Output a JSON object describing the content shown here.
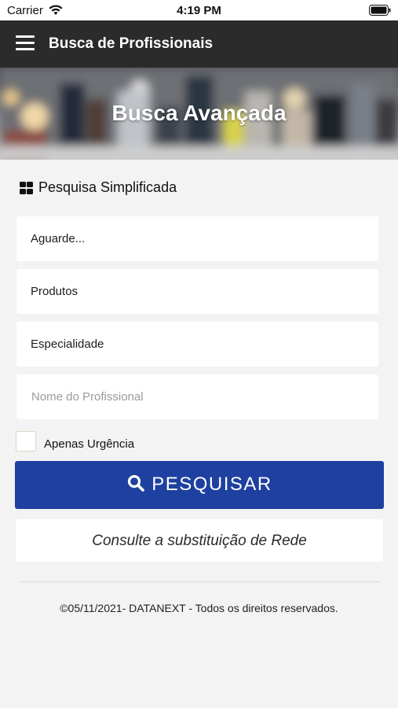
{
  "status_bar": {
    "carrier": "Carrier",
    "time": "4:19 PM",
    "icons": [
      "wifi-icon",
      "battery-icon"
    ]
  },
  "app_bar": {
    "title": "Busca de Profissionais",
    "menu_icon": "hamburger-menu-icon"
  },
  "banner": {
    "title": "Busca Avançada"
  },
  "section": {
    "icon": "grid-icon",
    "title": "Pesquisa Simplificada"
  },
  "fields": {
    "location": {
      "value": "Aguarde..."
    },
    "products": {
      "value": "Produtos"
    },
    "specialty": {
      "value": "Especialidade"
    },
    "professional_name": {
      "placeholder": "Nome do Profissional",
      "value": ""
    }
  },
  "urgency": {
    "label": "Apenas Urgência",
    "checked": false
  },
  "search_button": {
    "label": "PESQUISAR",
    "icon": "search-icon"
  },
  "network_button": {
    "label": "Consulte a substituição de Rede"
  },
  "footer": {
    "text": "©05/11/2021- DATANEXT - Todos os direitos reservados."
  },
  "colors": {
    "app_bar": "#2b2b2b",
    "primary_button": "#1e40a0",
    "background": "#f3f3f3"
  }
}
